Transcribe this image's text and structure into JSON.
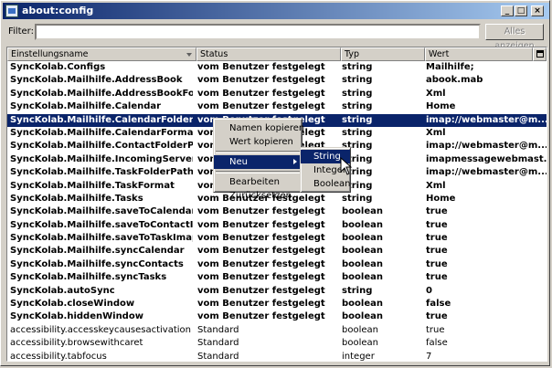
{
  "window": {
    "title": "about:config"
  },
  "filter": {
    "label": "Filter:",
    "value": "",
    "show_all_label": "Alles anzeigen"
  },
  "columns": [
    "Einstellungsname",
    "Status",
    "Typ",
    "Wert"
  ],
  "rows": [
    {
      "name": "SyncKolab.Configs",
      "status": "vom Benutzer festgelegt",
      "type": "string",
      "value": "Mailhilfe;",
      "bold": true
    },
    {
      "name": "SyncKolab.Mailhilfe.AddressBook",
      "status": "vom Benutzer festgelegt",
      "type": "string",
      "value": "abook.mab",
      "bold": true
    },
    {
      "name": "SyncKolab.Mailhilfe.AddressBookFormat",
      "status": "vom Benutzer festgelegt",
      "type": "string",
      "value": "Xml",
      "bold": true
    },
    {
      "name": "SyncKolab.Mailhilfe.Calendar",
      "status": "vom Benutzer festgelegt",
      "type": "string",
      "value": "Home",
      "bold": true
    },
    {
      "name": "SyncKolab.Mailhilfe.CalendarFolderPath",
      "status": "vom Benutzer festgelegt",
      "type": "string",
      "value": "imap://webmaster@m...",
      "bold": true,
      "selected": true
    },
    {
      "name": "SyncKolab.Mailhilfe.CalendarFormat",
      "status": "vom Benutzer festgelegt",
      "type": "string",
      "value": "Xml",
      "bold": true
    },
    {
      "name": "SyncKolab.Mailhilfe.ContactFolderPath",
      "status": "vom Benutzer festgelegt",
      "type": "string",
      "value": "imap://webmaster@m...",
      "bold": true
    },
    {
      "name": "SyncKolab.Mailhilfe.IncomingServer",
      "status": "vom Benutzer festgelegt",
      "type": "string",
      "value": "imapmessagewebmast...",
      "bold": true
    },
    {
      "name": "SyncKolab.Mailhilfe.TaskFolderPath",
      "status": "vom Benutzer festgelegt",
      "type": "string",
      "value": "imap://webmaster@m...",
      "bold": true
    },
    {
      "name": "SyncKolab.Mailhilfe.TaskFormat",
      "status": "vom Benutzer festgelegt",
      "type": "string",
      "value": "Xml",
      "bold": true
    },
    {
      "name": "SyncKolab.Mailhilfe.Tasks",
      "status": "vom Benutzer festgelegt",
      "type": "string",
      "value": "Home",
      "bold": true
    },
    {
      "name": "SyncKolab.Mailhilfe.saveToCalendarImap",
      "status": "vom Benutzer festgelegt",
      "type": "boolean",
      "value": "true",
      "bold": true
    },
    {
      "name": "SyncKolab.Mailhilfe.saveToContactImap",
      "status": "vom Benutzer festgelegt",
      "type": "boolean",
      "value": "true",
      "bold": true
    },
    {
      "name": "SyncKolab.Mailhilfe.saveToTaskImap",
      "status": "vom Benutzer festgelegt",
      "type": "boolean",
      "value": "true",
      "bold": true
    },
    {
      "name": "SyncKolab.Mailhilfe.syncCalendar",
      "status": "vom Benutzer festgelegt",
      "type": "boolean",
      "value": "true",
      "bold": true
    },
    {
      "name": "SyncKolab.Mailhilfe.syncContacts",
      "status": "vom Benutzer festgelegt",
      "type": "boolean",
      "value": "true",
      "bold": true
    },
    {
      "name": "SyncKolab.Mailhilfe.syncTasks",
      "status": "vom Benutzer festgelegt",
      "type": "boolean",
      "value": "true",
      "bold": true
    },
    {
      "name": "SyncKolab.autoSync",
      "status": "vom Benutzer festgelegt",
      "type": "string",
      "value": "0",
      "bold": true
    },
    {
      "name": "SyncKolab.closeWindow",
      "status": "vom Benutzer festgelegt",
      "type": "boolean",
      "value": "false",
      "bold": true
    },
    {
      "name": "SyncKolab.hiddenWindow",
      "status": "vom Benutzer festgelegt",
      "type": "boolean",
      "value": "true",
      "bold": true
    },
    {
      "name": "accessibility.accesskeycausesactivation",
      "status": "Standard",
      "type": "boolean",
      "value": "true",
      "bold": false
    },
    {
      "name": "accessibility.browsewithcaret",
      "status": "Standard",
      "type": "boolean",
      "value": "false",
      "bold": false
    },
    {
      "name": "accessibility.tabfocus",
      "status": "Standard",
      "type": "integer",
      "value": "7",
      "bold": false
    }
  ],
  "context_menu": {
    "items": [
      "Namen kopieren",
      "Wert kopieren",
      "Neu",
      "Bearbeiten",
      "Zurücksetzen"
    ]
  },
  "submenu": {
    "items": [
      "String",
      "Integer",
      "Boolean"
    ]
  },
  "colors": {
    "selection": "#0a246a",
    "titlebar_start": "#0a246a",
    "titlebar_end": "#a6caf0"
  }
}
